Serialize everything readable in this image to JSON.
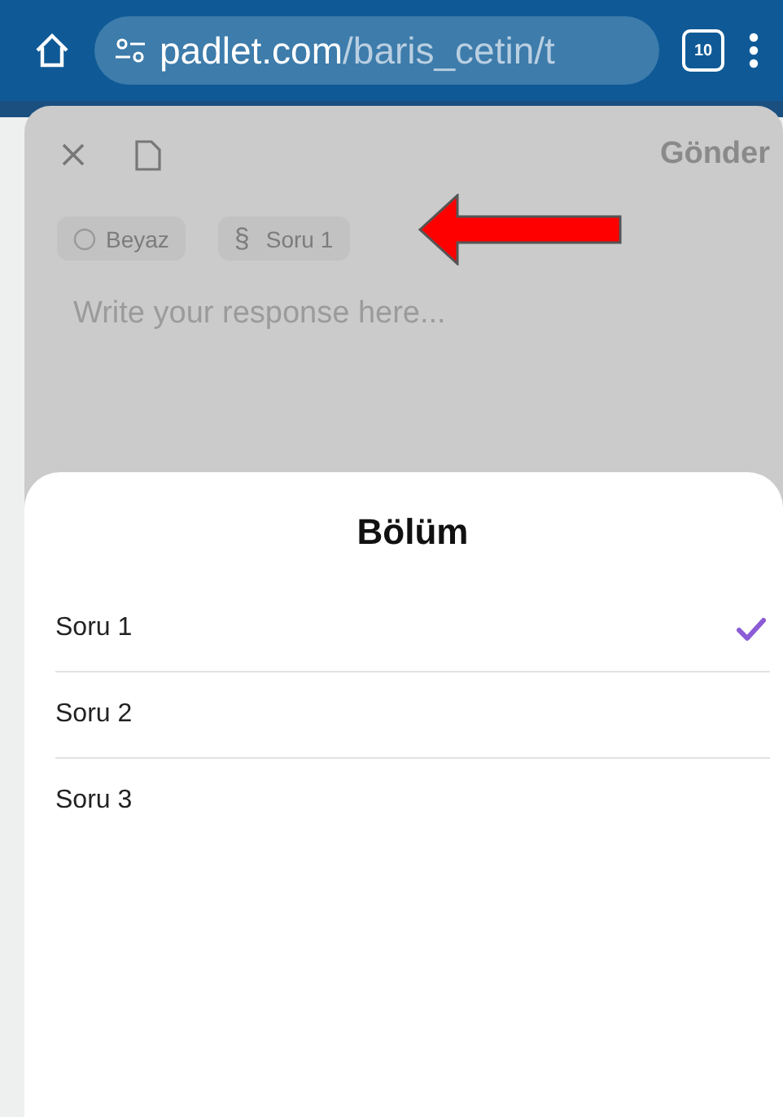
{
  "browser": {
    "url_host": "padlet.com",
    "url_path": "/baris_cetin/t",
    "tab_count": "10"
  },
  "composer": {
    "submit": "Gönder",
    "chips": [
      {
        "kind": "color",
        "label": "Beyaz"
      },
      {
        "kind": "section",
        "symbol": "§",
        "label": "Soru 1"
      }
    ],
    "placeholder": "Write your response here..."
  },
  "sheet": {
    "title": "Bölüm",
    "options": [
      {
        "label": "Soru 1",
        "selected": true
      },
      {
        "label": "Soru 2",
        "selected": false
      },
      {
        "label": "Soru 3",
        "selected": false
      }
    ]
  }
}
